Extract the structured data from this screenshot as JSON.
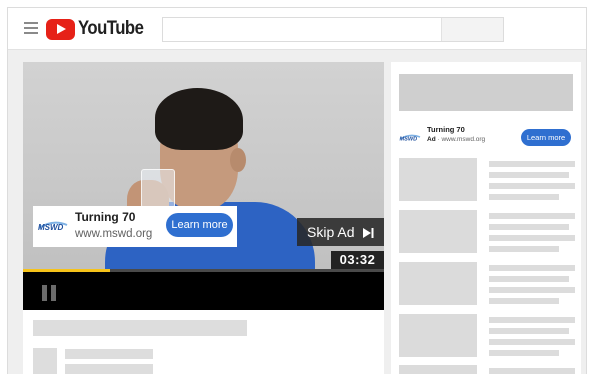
{
  "header": {
    "logo_text": "YouTube",
    "logo_icon": "youtube-play-icon",
    "menu_icon": "hamburger-menu-icon",
    "search": {
      "placeholder": "",
      "value": ""
    }
  },
  "player": {
    "ad_overlay": {
      "advertiser_logo": "MSWD",
      "title": "Turning 70",
      "url": "www.mswd.org",
      "cta_label": "Learn more"
    },
    "skip_label": "Skip Ad",
    "skip_icon": "skip-next-icon",
    "time_remaining": "03:32",
    "progress_fraction": 0.24,
    "progress_color": "#f6c31a",
    "play_state_icon": "pause-icon"
  },
  "sidebar": {
    "companion_ad": {
      "advertiser_logo": "MSWD",
      "title": "Turning 70",
      "ad_badge": "Ad",
      "url": "· www.mswd.org",
      "cta_label": "Learn more"
    }
  },
  "colors": {
    "brand_red": "#e62117",
    "accent_blue": "#2f6fd0"
  }
}
